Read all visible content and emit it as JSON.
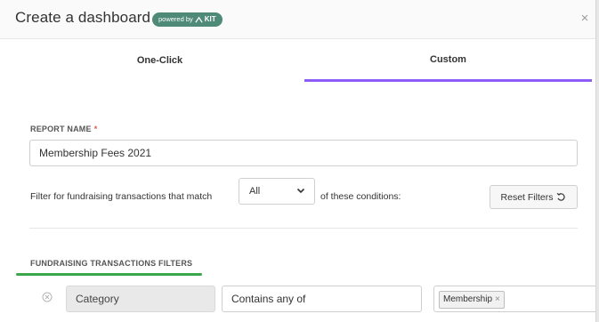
{
  "header": {
    "title": "Create a dashboard",
    "badge_prefix": "powered by",
    "badge_logo": "KIT",
    "close_glyph": "×"
  },
  "tabs": [
    {
      "label": "One-Click",
      "active": false
    },
    {
      "label": "Custom",
      "active": true
    }
  ],
  "report": {
    "label": "REPORT NAME",
    "required_mark": "*",
    "value": "Membership Fees 2021"
  },
  "match": {
    "prefix": "Filter for fundraising transactions that match",
    "selected": "All",
    "suffix": "of these conditions:"
  },
  "reset_button": {
    "label": "Reset Filters",
    "icon": "undo-icon"
  },
  "filters_section": {
    "label": "FUNDRAISING TRANSACTIONS FILTERS",
    "rows": [
      {
        "field": "Category",
        "operator": "Contains any of",
        "values": [
          "Membership"
        ]
      }
    ]
  },
  "colors": {
    "accent_tab": "#8b5cf6",
    "accent_underline": "#3aa84a",
    "badge_bg": "#4f8a79",
    "required": "#e2574c"
  }
}
